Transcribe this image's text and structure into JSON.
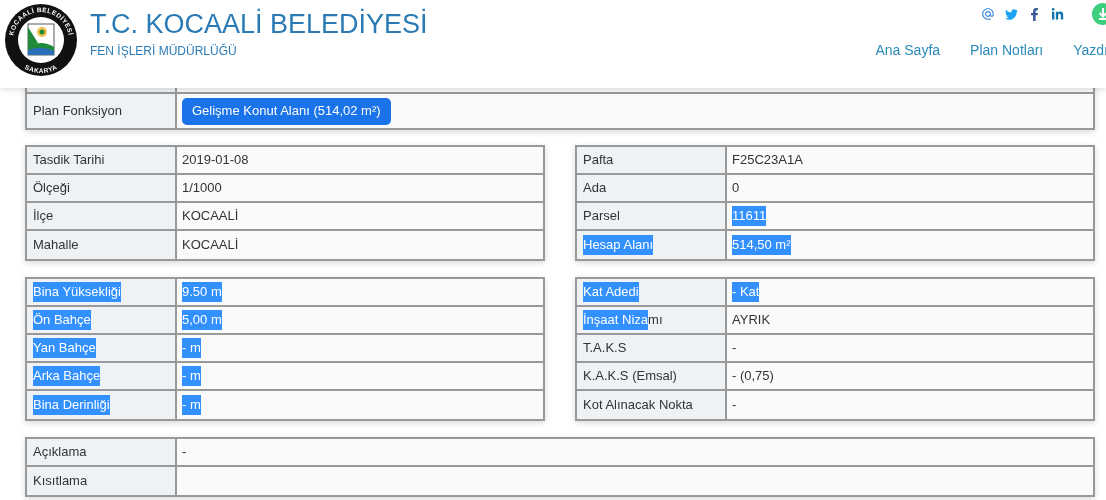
{
  "header": {
    "logo": {
      "top_text": "KOCAALİ BELEDİYESİ",
      "bottom_text": "SAKARYA"
    },
    "title": "T.C. KOCAALİ BELEDİYESİ",
    "subtitle": "FEN İŞLERİ MÜDÜRLÜĞÜ",
    "nav": [
      "Ana Sayfa",
      "Plan Notları",
      "Yazdı"
    ]
  },
  "plan_function": {
    "label": "Plan Fonksiyon",
    "button": "Gelişme Konut Alanı (514,02 m²)"
  },
  "tables": [
    {
      "rows": [
        {
          "label": [
            {
              "text": "Tasdik Tarihi",
              "selected": false
            }
          ],
          "value": [
            {
              "text": "2019-01-08",
              "selected": false
            }
          ]
        },
        {
          "label": [
            {
              "text": "Ölçeği",
              "selected": false
            }
          ],
          "value": [
            {
              "text": "1/1000",
              "selected": false
            }
          ]
        },
        {
          "label": [
            {
              "text": "İlçe",
              "selected": false
            }
          ],
          "value": [
            {
              "text": "KOCAALİ",
              "selected": false
            }
          ]
        },
        {
          "label": [
            {
              "text": "Mahalle",
              "selected": false
            }
          ],
          "value": [
            {
              "text": "KOCAALİ",
              "selected": false
            }
          ]
        }
      ]
    },
    {
      "rows": [
        {
          "label": [
            {
              "text": "Pafta",
              "selected": false
            }
          ],
          "value": [
            {
              "text": "F25C23A1A",
              "selected": false
            }
          ]
        },
        {
          "label": [
            {
              "text": "Ada",
              "selected": false
            }
          ],
          "value": [
            {
              "text": "0",
              "selected": false
            }
          ]
        },
        {
          "label": [
            {
              "text": "Parsel",
              "selected": false
            }
          ],
          "value": [
            {
              "text": "11611",
              "selected": true
            }
          ]
        },
        {
          "label": [
            {
              "text": "Hesap Alanı",
              "selected": true
            }
          ],
          "value": [
            {
              "text": "514,50 m²",
              "selected": true
            }
          ]
        }
      ]
    },
    {
      "rows": [
        {
          "label": [
            {
              "text": "Bina Yüksekliği",
              "selected": true
            }
          ],
          "value": [
            {
              "text": "9.50 m",
              "selected": true
            }
          ]
        },
        {
          "label": [
            {
              "text": "Ön Bahçe",
              "selected": true
            }
          ],
          "value": [
            {
              "text": "5,00 m",
              "selected": true
            }
          ]
        },
        {
          "label": [
            {
              "text": "Yan Bahçe",
              "selected": true
            }
          ],
          "value": [
            {
              "text": "- m",
              "selected": true
            }
          ]
        },
        {
          "label": [
            {
              "text": "Arka Bahçe",
              "selected": true
            }
          ],
          "value": [
            {
              "text": "- m",
              "selected": true
            }
          ]
        },
        {
          "label": [
            {
              "text": "Bina Derinliği",
              "selected": true
            }
          ],
          "value": [
            {
              "text": "- m",
              "selected": true
            }
          ]
        }
      ]
    },
    {
      "rows": [
        {
          "label": [
            {
              "text": "Kat Adedi",
              "selected": true
            }
          ],
          "value": [
            {
              "text": "- Kat",
              "selected": true
            }
          ]
        },
        {
          "label": [
            {
              "text": "İnşaat Niza",
              "selected": true
            },
            {
              "text": "mı",
              "selected": false
            }
          ],
          "value": [
            {
              "text": "AYRIK",
              "selected": false
            }
          ]
        },
        {
          "label": [
            {
              "text": "T.A.K.S",
              "selected": false
            }
          ],
          "value": [
            {
              "text": "-",
              "selected": false
            }
          ]
        },
        {
          "label": [
            {
              "text": "K.A.K.S (Emsal)",
              "selected": false
            }
          ],
          "value": [
            {
              "text": "- (0,75)",
              "selected": false
            }
          ]
        },
        {
          "label": [
            {
              "text": "Kot Alınacak Nokta",
              "selected": false
            }
          ],
          "value": [
            {
              "text": "-",
              "selected": false
            }
          ]
        }
      ]
    }
  ],
  "notes": [
    {
      "label": "Açıklama",
      "value": "-"
    },
    {
      "label": "Kısıtlama"
    }
  ]
}
